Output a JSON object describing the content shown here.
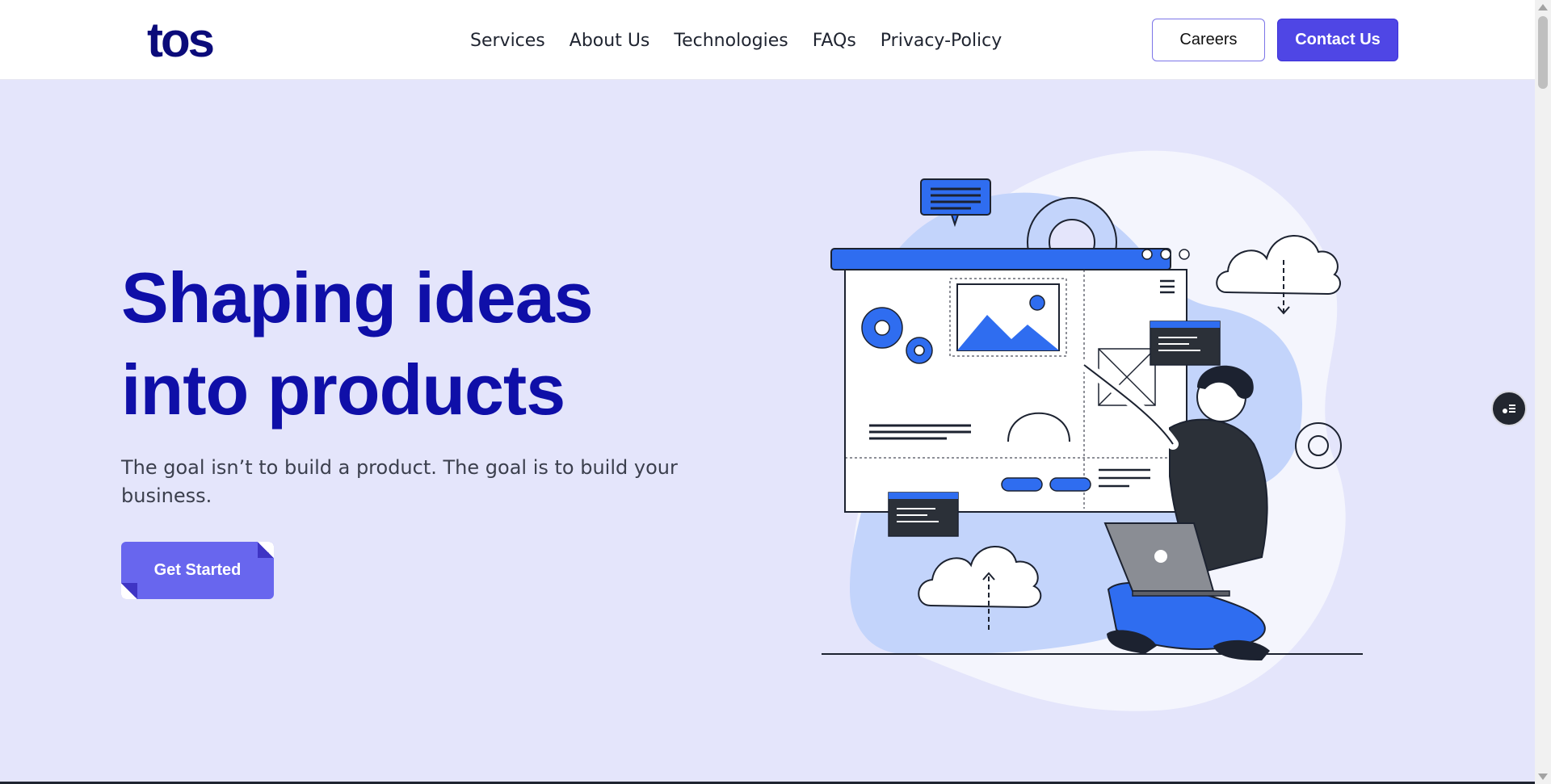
{
  "header": {
    "logo_text": "tos",
    "nav": [
      "Services",
      "About Us",
      "Technologies",
      "FAQs",
      "Privacy-Policy"
    ],
    "careers_label": "Careers",
    "contact_label": "Contact Us"
  },
  "hero": {
    "title_line1": "Shaping ideas",
    "title_line2": "into products",
    "subtitle": "The goal isn’t to build a product. The goal is to build your business.",
    "cta_label": "Get Started"
  },
  "colors": {
    "brand_dark": "#0f0fa8",
    "accent": "#4f46e5",
    "hero_bg": "#e4e5fb",
    "illustration_blue": "#2f6df0"
  },
  "icons": [
    "chat-bubble-icon",
    "gear-icon",
    "cloud-download-icon",
    "cloud-upload-icon",
    "image-icon",
    "laptop-icon",
    "menu-icon",
    "widget-icon"
  ]
}
